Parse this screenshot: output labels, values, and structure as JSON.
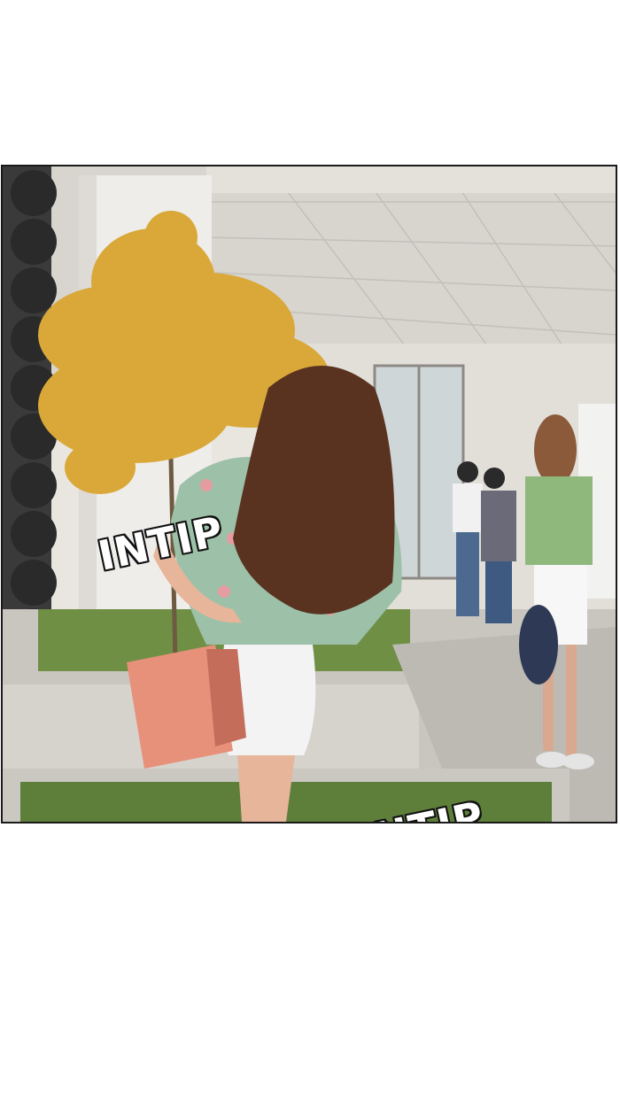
{
  "panel": {
    "sfx": [
      "INTIP",
      "INTIP"
    ]
  },
  "colors": {
    "border": "#1a1a1a",
    "background": "#ffffff",
    "tree": "#d9a838",
    "hair": "#5a3320",
    "bag": "#e7907a"
  }
}
